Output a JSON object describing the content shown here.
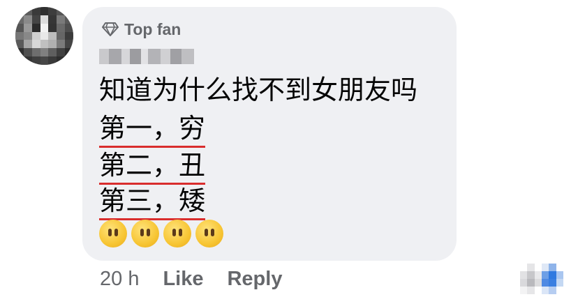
{
  "comment": {
    "badge_label": "Top fan",
    "lines": [
      "知道为什么找不到女朋友吗",
      "第一，穷",
      "第二，丑",
      "第三，矮"
    ],
    "emojis": [
      "face-without-mouth",
      "face-without-mouth",
      "face-without-mouth",
      "face-without-mouth"
    ],
    "underline_color": "#d92d2d"
  },
  "actions": {
    "time": "20 h",
    "like_label": "Like",
    "reply_label": "Reply"
  }
}
